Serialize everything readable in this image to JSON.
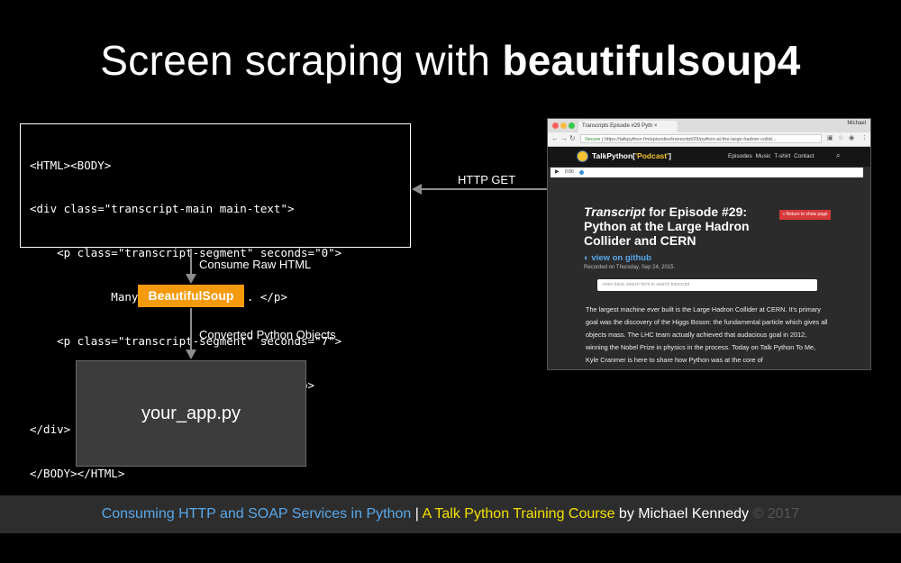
{
  "title": {
    "prefix": "Screen scraping with ",
    "bold": "beautifulsoup4"
  },
  "code_lines": [
    "<HTML><BODY>",
    "<div class=\"transcript-main main-text\">",
    "    <p class=\"transcript-segment\" seconds=\"0\">",
    "            Many of you write ... </p>",
    "    <p class=\"transcript-segment\" seconds=\"7\">",
    "            This week you'll meet ... </p>",
    "</div>",
    "</BODY></HTML>"
  ],
  "labels": {
    "http_get": "HTTP GET",
    "consume": "Consume Raw HTML",
    "converted": "Converted Python Objects"
  },
  "beautifulsoup": "BeautifulSoup",
  "app": "your_app.py",
  "browser": {
    "tab_title": "Transcripts Episode #29 Pyth",
    "user": "Michael",
    "secure": "Secure",
    "url": "https://talkpython.fm/episodes/transcript/29/python-at-the-large-hadron-collid...",
    "site_name_prefix": "TalkPython[",
    "site_name_accent": "'Podcast'",
    "site_name_suffix": "]",
    "nav": [
      "Episodes",
      "Music",
      "T-shirt",
      "Contact"
    ],
    "player_time": "0:00",
    "ep_italic": "Transcript",
    "ep_rest": " for Episode #29: Python at the Large Hadron Collider and CERN",
    "return_btn": "« Return to show page",
    "github": "view on github",
    "recorded": "Recorded on Thursday, Sep 24, 2015.",
    "search_placeholder": "enter basic search term to search transcript",
    "body": "The largest machine ever built is the Large Hadron Collider at CERN. It's primary goal was the discovery of the Higgs Boson: the fundamental particle which gives all objects mass. The LHC team actually achieved that audacious goal in 2012, winning the Nobel Prize in physics in the process. Today on Talk Python To Me, Kyle Cranmer is here to share how Python was at the core of"
  },
  "footer": {
    "course": "Consuming HTTP and SOAP Services in Python",
    "sep": " | ",
    "training": "A Talk Python Training Course",
    "by": " by Michael Kennedy ",
    "copy": "© 2017",
    "colors": {
      "course": "#5aa7e8",
      "training": "#f5e000",
      "by": "#ffffff",
      "copy": "#555555"
    }
  }
}
